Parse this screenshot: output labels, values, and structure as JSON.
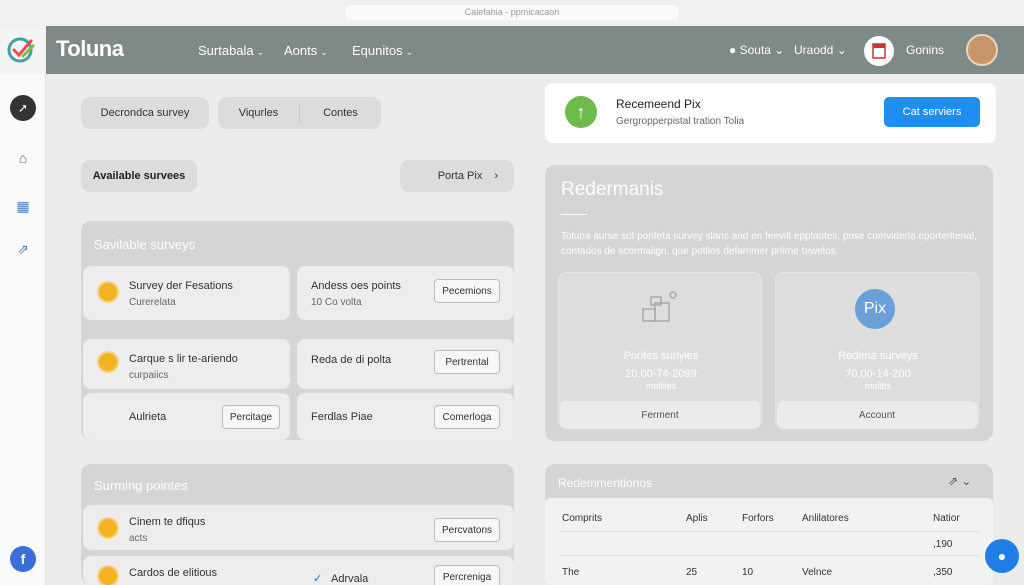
{
  "browser": {
    "title": "Calefahia - ppmicacaon"
  },
  "header": {
    "logo": "Toluna",
    "nav": [
      {
        "label": "Surtabala"
      },
      {
        "label": "Aonts"
      },
      {
        "label": "Equnitos"
      }
    ],
    "user_menu": "Souta",
    "region_menu": "Uraodd",
    "account_label": "Gonins"
  },
  "colors": {
    "accent_blue": "#1f8ef1",
    "header_bg": "#7e8a88",
    "coin": "#f3b324",
    "green": "#6dbb4a"
  },
  "filters": {
    "decronda": "Decrondca survey",
    "viquries": "Viqurles",
    "contes": "Contes",
    "available": "Available survees",
    "porta_pix": "Porta Pix"
  },
  "available_panel": {
    "title": "Savilable surveys",
    "items": [
      {
        "title": "Survey der Fesations",
        "subtitle": "Curerelata"
      },
      {
        "title": "Andess oes points",
        "subtitle": "10 Co volta",
        "button": "Pecemions"
      },
      {
        "title": "Carque s lir te-ariendo",
        "subtitle": "curpaiics"
      },
      {
        "title": "Reda de di polta",
        "button": "Pertrental"
      },
      {
        "title": "Aulrieta",
        "button": "Percitage"
      },
      {
        "title": "Ferdlas Piae",
        "button": "Comerloga"
      }
    ]
  },
  "earning_panel": {
    "title": "Surming pointes",
    "items": [
      {
        "title": "Cinem te dfiqus",
        "subtitle": "acts",
        "button": "Percvatons"
      },
      {
        "title": "Cardos de elitious",
        "check_label": "Adrvala",
        "button": "Percreniga"
      }
    ]
  },
  "recommend": {
    "title": "Recemeend Pix",
    "subtitle": "Gergropperpistal tration Tolia",
    "button": "Cat serviers"
  },
  "redemption": {
    "title": "Redermanis",
    "description": "Toluna aurse sot porifeta survey slans and en feevilt epplaotes, pose comviderla eporterltenal, contados de scormalign, que potlios defammer prlirne tewelos.",
    "cards": [
      {
        "title": "Porites surlyles",
        "value": "20,00-74-2099",
        "unit": "mollites",
        "button": "Ferment"
      },
      {
        "title": "Redena surveys",
        "value": "70,00-14-200",
        "unit": "molitts",
        "button": "Account",
        "badge": "Pix"
      }
    ]
  },
  "redemptions_table": {
    "title": "Redemmentionos",
    "columns": [
      "Comprits",
      "Aplis",
      "Forfors",
      "Anlilatores",
      "Natior"
    ],
    "rows": [
      [
        "",
        "",
        "",
        "",
        ",190"
      ],
      [
        "The",
        "25",
        "10",
        "Velnce",
        ",350"
      ]
    ]
  },
  "icons": [
    "check-logo-icon",
    "compass-icon",
    "bank-icon",
    "chart-icon",
    "share-icon",
    "facebook-icon",
    "chat-icon",
    "link-icon"
  ]
}
